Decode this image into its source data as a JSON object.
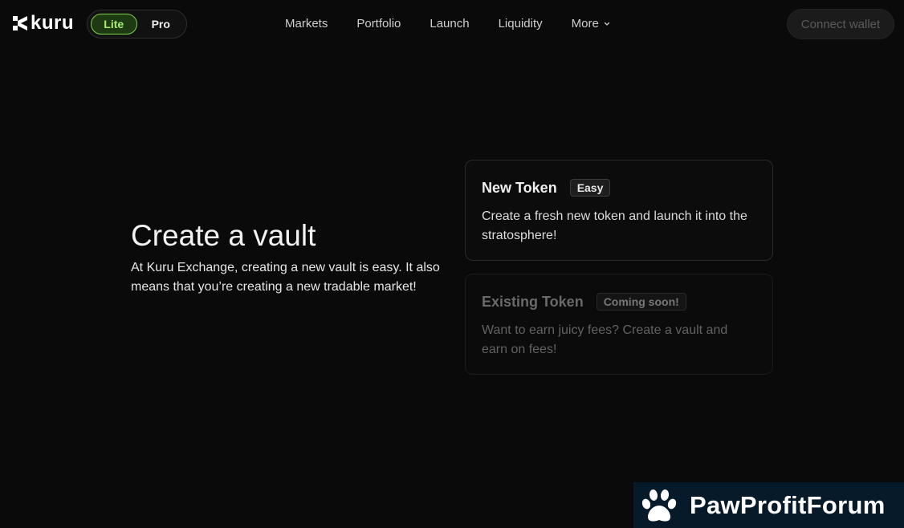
{
  "header": {
    "logo_text": "kuru",
    "mode_toggle": {
      "lite_label": "Lite",
      "pro_label": "Pro",
      "active": "Lite"
    },
    "nav": {
      "markets": "Markets",
      "portfolio": "Portfolio",
      "launch": "Launch",
      "liquidity": "Liquidity",
      "more": "More"
    },
    "connect_wallet": "Connect wallet"
  },
  "hero": {
    "title": "Create a vault",
    "description": "At Kuru Exchange, creating a new vault is easy. It also means that you’re creating a new tradable market!"
  },
  "cards": {
    "new_token": {
      "title": "New Token",
      "badge": "Easy",
      "description": "Create a fresh new token and launch it into the stratosphere!"
    },
    "existing_token": {
      "title": "Existing Token",
      "badge": "Coming soon!",
      "description": "Want to earn juicy fees? Create a vault and earn on fees!"
    }
  },
  "watermark": {
    "text": "PawProfitForum"
  },
  "colors": {
    "background": "#0a0a0a",
    "accent_green": "#a6ef6d",
    "watermark_bg": "#071a2a"
  }
}
